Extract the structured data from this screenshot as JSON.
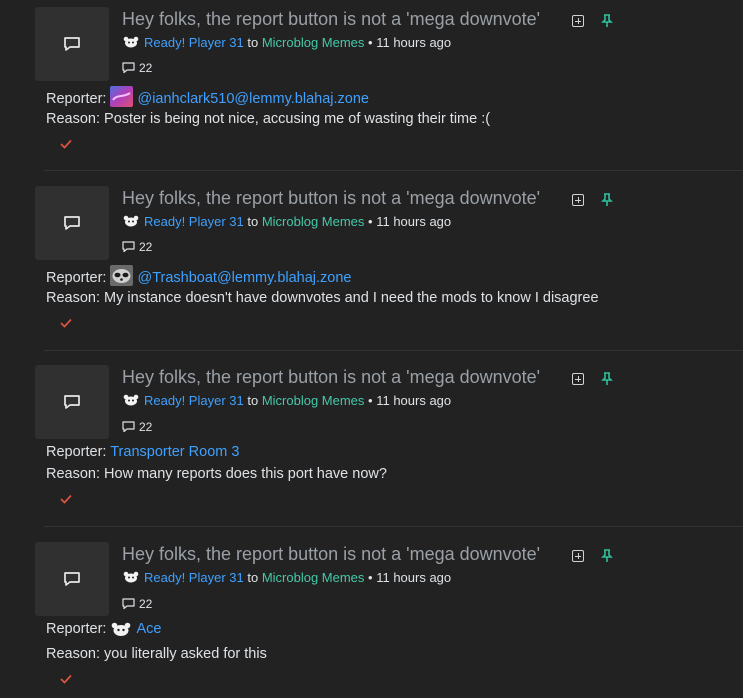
{
  "post": {
    "title": "Hey folks, the report button is not a 'mega downvote'",
    "author": "Ready! Player 31",
    "to_word": "to",
    "community": "Microblog Memes",
    "time": "• 11 hours ago",
    "comment_count": "22"
  },
  "labels": {
    "reporter": "Reporter:",
    "reason": "Reason:"
  },
  "reports": [
    {
      "reporter": "@ianhclark510@lemmy.blahaj.zone",
      "avatar_icon": "gradient-avatar-icon",
      "reason": "Poster is being not nice, accusing me of wasting their time :("
    },
    {
      "reporter": "@Trashboat@lemmy.blahaj.zone",
      "avatar_icon": "raccoon-avatar-icon",
      "reason": "My instance doesn't have downvotes and I need the mods to know I disagree"
    },
    {
      "reporter": "Transporter Room 3",
      "avatar_icon": "",
      "reason": "How many reports does this port have now?"
    },
    {
      "reporter": "Ace",
      "avatar_icon": "mascot-avatar-icon",
      "reason": "you literally asked for this"
    }
  ],
  "colors": {
    "background": "#222222",
    "link_blue": "#3fa1ff",
    "community_teal": "#45c8a8",
    "pin_green": "#2fbf9b",
    "resolve_red": "#e0533f"
  }
}
